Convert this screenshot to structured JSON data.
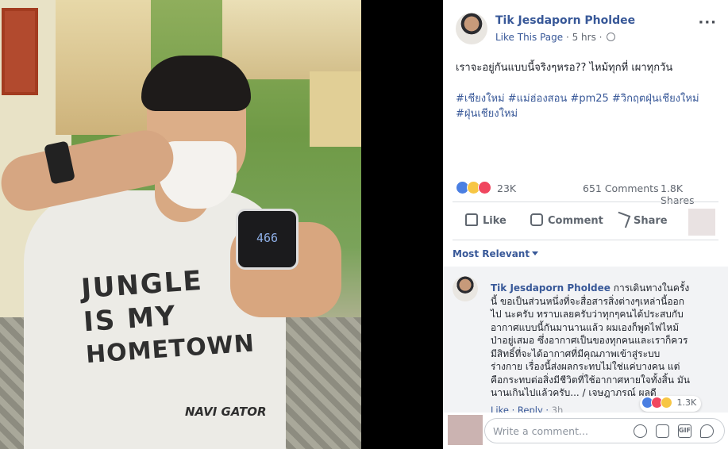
{
  "post": {
    "author": "Tik Jesdaporn Pholdee",
    "like_page": "Like This Page",
    "separator": " · ",
    "time": "5 hrs",
    "separator2": " · ",
    "text": "เราจะอยู่กันแบบนี้จริงๆหรอ?? ไหม้ทุกที่ เผาทุกวัน",
    "hashtags": "#เชียงใหม่ #แม่ฮ่องสอน #pm25 #วิกฤตฝุ่นเชียงใหม่ #ฝุ่นเชียงใหม่",
    "more_label": "···"
  },
  "photo": {
    "device_reading": "466",
    "shirt_line1": "JUNGLE",
    "shirt_line2": "IS MY",
    "shirt_line3": "HOMETOWN",
    "shirt_logo": "NAVI GATOR"
  },
  "stats": {
    "reaction_count": "23K",
    "comments": "651 Comments",
    "shares": "1.8K Shares"
  },
  "actions": {
    "like": "Like",
    "comment": "Comment",
    "share": "Share"
  },
  "sort": {
    "label": "Most Relevant"
  },
  "comment": {
    "author": "Tik Jesdaporn Pholdee",
    "text": "การเดินทางในครั้งนี้ ขอเป็นส่วนหนึ่งที่จะสื่อสารสิ่งต่างๆเหล่านี้ออกไป นะครับ ทราบเลยครับว่าทุกๆคนได้ประสบกับ อากาศแบบนี้กันมานานแล้ว ผมเองก็พูดไฟไหม้ ป่าอยู่เสมอ ซึ่งอากาศเป็นของทุกคนและเราก็ควร มีสิทธิ์ที่จะได้อากาศที่มีคุณภาพเข้าสู่ระบบ ร่างกาย เรื่องนี้ส่งผลกระทบไม่ใช่แค่บางคน แต่ คือกระทบต่อสิ่งมีชีวิตที่ใช้อากาศหายใจทั้งสิ้น มันนานเกินไปแล้วครับ... / เจษฎาภรณ์ ผลดี",
    "reaction_count": "1.3K",
    "like_link": "Like",
    "reply_link": "Reply",
    "link_separator": " · ",
    "time": "3h"
  },
  "composer": {
    "placeholder": "Write a comment..."
  },
  "colors": {
    "link": "#385898",
    "like_blue": "#4a7fe2",
    "love_red": "#f0465f",
    "sad_yellow": "#f7c644"
  },
  "icons": [
    "globe-icon",
    "more-icon",
    "like-reaction-icon",
    "sad-reaction-icon",
    "love-reaction-icon",
    "thumbs-up-icon",
    "comment-icon",
    "share-icon",
    "caret-down-icon",
    "emoji-icon",
    "camera-icon",
    "gif-icon",
    "sticker-icon"
  ]
}
